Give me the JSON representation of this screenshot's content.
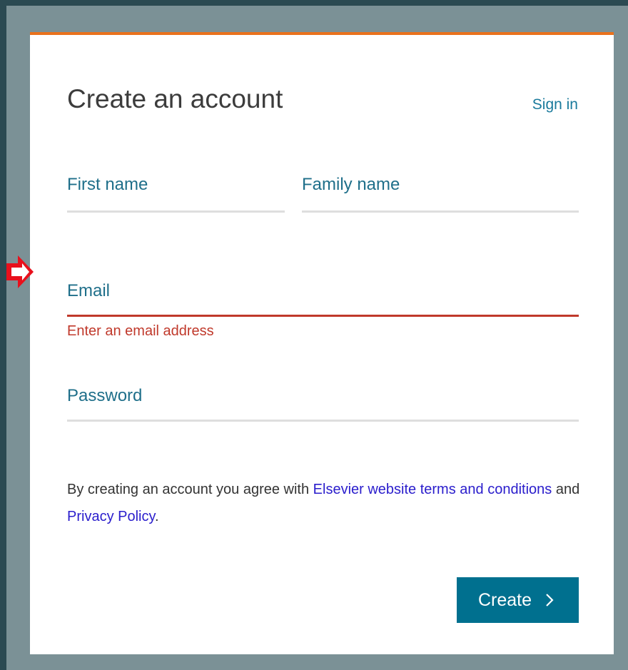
{
  "form": {
    "title": "Create an account",
    "sign_in_label": "Sign in",
    "fields": {
      "first_name": {
        "label": "First name",
        "value": ""
      },
      "family_name": {
        "label": "Family name",
        "value": ""
      },
      "email": {
        "label": "Email",
        "value": "",
        "error": "Enter an email address"
      },
      "password": {
        "label": "Password",
        "value": ""
      }
    },
    "terms": {
      "prefix": "By creating an account you agree with ",
      "terms_link": "Elsevier website terms and conditions",
      "middle": " and ",
      "privacy_link": "Privacy Policy",
      "suffix": "."
    },
    "create_label": "Create"
  },
  "annotation": {
    "icon": "red-arrow-icon",
    "color": "#e8101c"
  },
  "colors": {
    "accent_top_border": "#e9711c",
    "label_teal": "#1f6f8a",
    "error_red": "#c0392b",
    "button_bg": "#00708f",
    "link_blue": "#2a1dcc"
  }
}
